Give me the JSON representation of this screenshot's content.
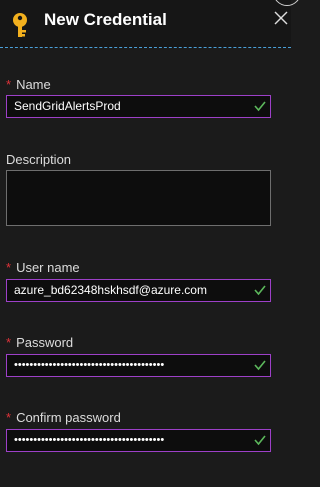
{
  "header": {
    "title": "New Credential",
    "icon": "key-icon",
    "close_icon": "close-icon"
  },
  "fields": {
    "name": {
      "label": "Name",
      "required": "*",
      "value": "SendGridAlertsProd"
    },
    "description": {
      "label": "Description",
      "value": ""
    },
    "username": {
      "label": "User name",
      "required": "*",
      "value": "azure_bd62348hskhsdf@azure.com"
    },
    "password": {
      "label": "Password",
      "required": "*",
      "value": "•••••••••••••••••••••••••••••••••••••••"
    },
    "confirm_password": {
      "label": "Confirm password",
      "required": "*",
      "value": "•••••••••••••••••••••••••••••••••••••••"
    }
  },
  "colors": {
    "accent": "#9d40c8",
    "required": "#e0333a",
    "valid_check": "#5cb85c",
    "header_divider": "#4a9fd8",
    "key_icon": "#f2b01e"
  }
}
